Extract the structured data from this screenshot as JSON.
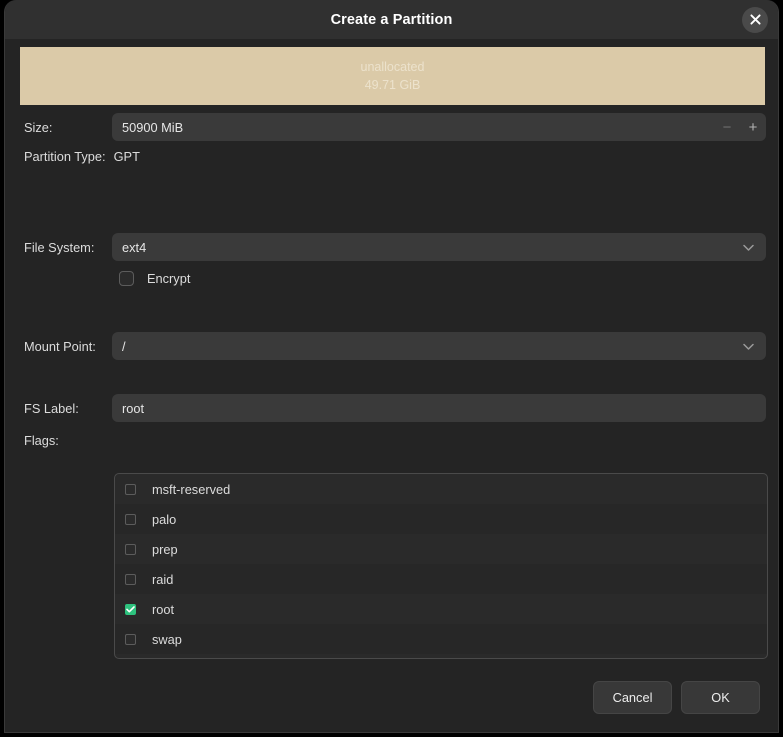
{
  "dialog": {
    "title": "Create a Partition",
    "close_icon": "close-icon"
  },
  "disk_bar": {
    "label": "unallocated",
    "size": "49.71 GiB",
    "color": "#dbcaa8"
  },
  "form": {
    "size": {
      "label": "Size:",
      "value": "50900 MiB",
      "decrement": "−",
      "increment": "+"
    },
    "partition_type": {
      "label": "Partition Type:",
      "value": "GPT"
    },
    "file_system": {
      "label": "File System:",
      "value": "ext4"
    },
    "encrypt": {
      "label": "Encrypt",
      "checked": false
    },
    "mount_point": {
      "label": "Mount Point:",
      "value": "/"
    },
    "fs_label": {
      "label": "FS Label:",
      "value": "root"
    },
    "flags": {
      "label": "Flags:",
      "accent": "#2ec27e",
      "items": [
        {
          "label": "msft-reserved",
          "checked": false
        },
        {
          "label": "palo",
          "checked": false
        },
        {
          "label": "prep",
          "checked": false
        },
        {
          "label": "raid",
          "checked": false
        },
        {
          "label": "root",
          "checked": true
        },
        {
          "label": "swap",
          "checked": false
        }
      ]
    }
  },
  "footer": {
    "cancel": "Cancel",
    "ok": "OK"
  }
}
